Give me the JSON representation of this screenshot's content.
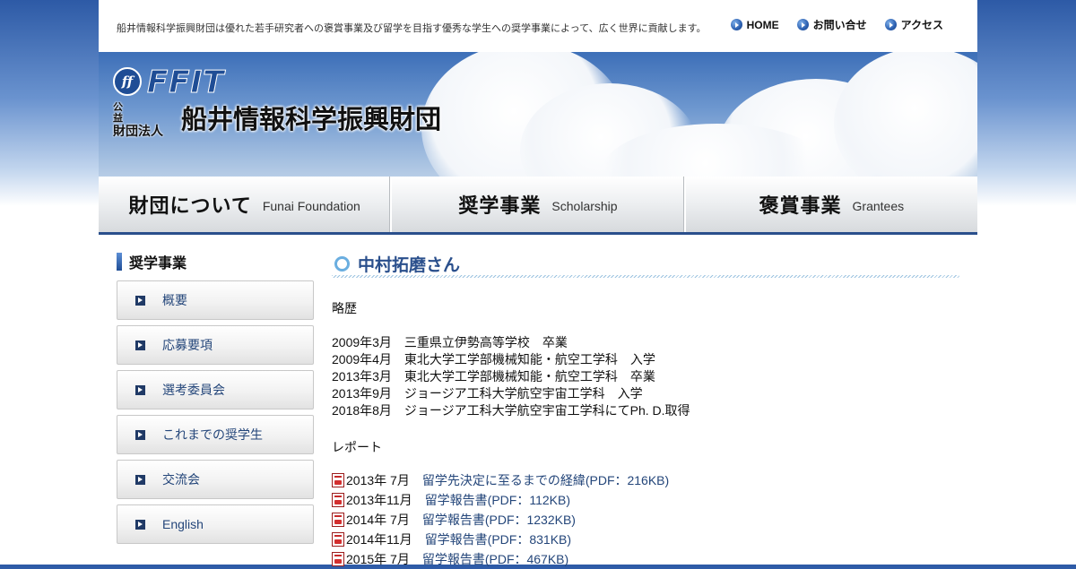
{
  "header": {
    "tagline": "船井情報科学振興財団は優れた若手研究者への褒賞事業及び留学を目指す優秀な学生への奨学事業によって、広く世界に貢献します。",
    "links": [
      {
        "label": "HOME",
        "icon": "circle-arrow-icon"
      },
      {
        "label": "お問い合せ",
        "icon": "circle-arrow-icon"
      },
      {
        "label": "アクセス",
        "icon": "circle-arrow-icon"
      }
    ]
  },
  "banner": {
    "logo_mark": "ff",
    "logo_text": "FFIT",
    "org_kind_top": "公 益",
    "org_kind_bottom": "財団法人",
    "org_name": "船井情報科学振興財団"
  },
  "global_nav": [
    {
      "jp": "財団について",
      "en": "Funai Foundation"
    },
    {
      "jp": "奨学事業",
      "en": "Scholarship"
    },
    {
      "jp": "褒賞事業",
      "en": "Grantees"
    }
  ],
  "sidebar": {
    "title": "奨学事業",
    "items": [
      {
        "label": "概要"
      },
      {
        "label": "応募要項"
      },
      {
        "label": "選考委員会"
      },
      {
        "label": "これまでの奨学生"
      },
      {
        "label": "交流会"
      },
      {
        "label": "English"
      }
    ]
  },
  "main": {
    "title": "中村拓磨さん",
    "history_heading": "略歴",
    "history": [
      "2009年3月　三重県立伊勢高等学校　卒業",
      "2009年4月　東北大学工学部機械知能・航空工学科　入学",
      "2013年3月　東北大学工学部機械知能・航空工学科　卒業",
      "2013年9月　ジョージア工科大学航空宇宙工学科　入学",
      "2018年8月　ジョージア工科大学航空宇宙工学科にてPh. D.取得"
    ],
    "report_heading": "レポート",
    "reports": [
      {
        "date": "2013年 7月",
        "link": "留学先決定に至るまでの経緯(PDF：216KB)"
      },
      {
        "date": "2013年11月",
        "link": "留学報告書(PDF：112KB)"
      },
      {
        "date": "2014年 7月",
        "link": "留学報告書(PDF：1232KB)"
      },
      {
        "date": "2014年11月",
        "link": "留学報告書(PDF：831KB)"
      },
      {
        "date": "2015年 7月",
        "link": "留学報告書(PDF：467KB)"
      }
    ]
  }
}
